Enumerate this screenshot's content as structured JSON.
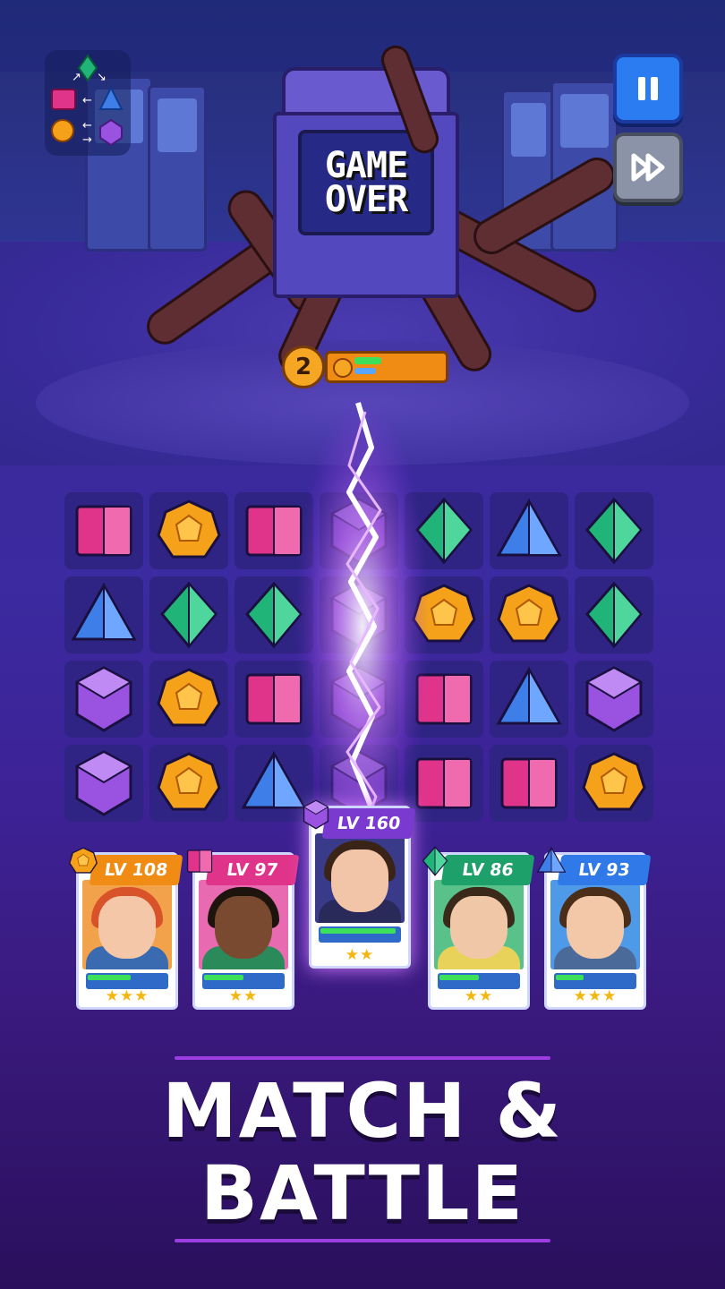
{
  "arcade": {
    "screen_line1": "GAME",
    "screen_line2": "OVER"
  },
  "enemy": {
    "level": "2",
    "hp_fraction": 0.25,
    "charge_fraction": 0.2
  },
  "hint_panel": {
    "icons": [
      "green-gem",
      "pink-gem",
      "blue-gem",
      "orange-gem",
      "purple-gem"
    ]
  },
  "controls": {
    "pause_icon": "pause-icon",
    "fast_forward_icon": "fast-forward-icon"
  },
  "board": {
    "rows": [
      [
        "pink",
        "orange",
        "pink",
        "purple",
        "green",
        "blue",
        "green"
      ],
      [
        "blue",
        "green",
        "green",
        "purple",
        "orange",
        "orange",
        "green"
      ],
      [
        "purple",
        "orange",
        "pink",
        "purple",
        "pink",
        "blue",
        "purple"
      ],
      [
        "purple",
        "orange",
        "blue",
        "purple",
        "pink",
        "pink",
        "orange"
      ]
    ],
    "colors": {
      "pink": "#e0348a",
      "orange": "#f5a21a",
      "blue": "#3e7ee8",
      "green": "#20b479",
      "purple": "#9a52e0"
    }
  },
  "heroes": [
    {
      "level": "LV 108",
      "gem": "orange",
      "stars": "★★★",
      "hp": 0.55,
      "sp": 0.0,
      "header_color": "#f08c14",
      "bg": "#f2a24a",
      "hair": "#d8522a",
      "skin": "#f4c7a8",
      "shirt": "#3a6ab0"
    },
    {
      "level": "LV 97",
      "gem": "pink",
      "stars": "★★",
      "hp": 0.5,
      "sp": 0.0,
      "header_color": "#e0348a",
      "bg": "#e86ab0",
      "hair": "#1e140e",
      "skin": "#7a4a30",
      "shirt": "#2a8a5a"
    },
    {
      "level": "LV 160",
      "gem": "purple",
      "stars": "★★",
      "hp": 0.95,
      "sp": 0.0,
      "header_color": "#7a3ad0",
      "bg": "#3a3a8a",
      "hair": "#3a2418",
      "skin": "#f2c4a8",
      "shirt": "#2a2a5a"
    },
    {
      "level": "LV 86",
      "gem": "green",
      "stars": "★★",
      "hp": 0.5,
      "sp": 0.0,
      "header_color": "#1ea06a",
      "bg": "#58c28a",
      "hair": "#3a2818",
      "skin": "#f0c8a8",
      "shirt": "#e8d25a"
    },
    {
      "level": "LV 93",
      "gem": "blue",
      "stars": "★★★",
      "hp": 0.35,
      "sp": 0.0,
      "header_color": "#2f7ae8",
      "bg": "#4f9ae8",
      "hair": "#4a2e1a",
      "skin": "#f2c8a8",
      "shirt": "#4a6a9a"
    }
  ],
  "slogan": {
    "line1": "MATCH &",
    "line2": "BATTLE"
  }
}
